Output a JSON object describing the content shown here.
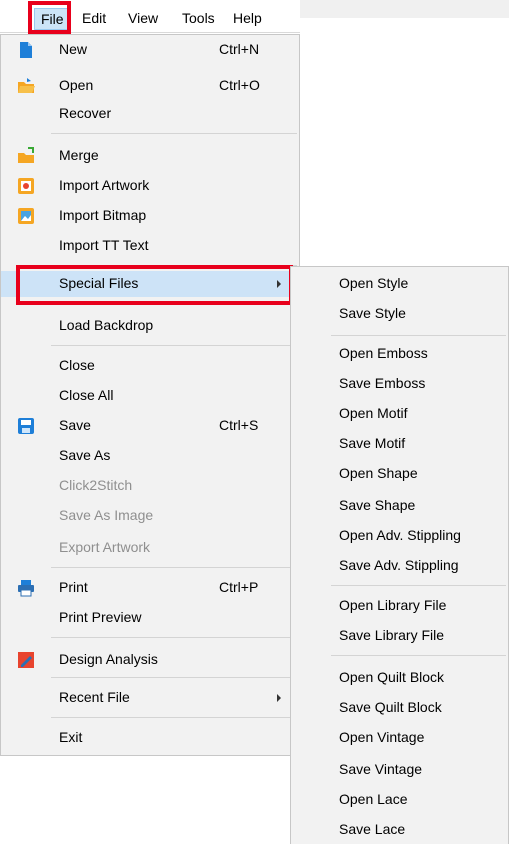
{
  "menubar": {
    "file": "File",
    "edit": "Edit",
    "view": "View",
    "tools": "Tools",
    "help": "Help"
  },
  "file_menu": {
    "items": [
      {
        "label": "New",
        "shortcut": "Ctrl+N",
        "icon": "new-file-icon"
      },
      {
        "label": "Open",
        "shortcut": "Ctrl+O",
        "icon": "open-folder-icon"
      },
      {
        "label": "Recover",
        "shortcut": ""
      },
      {
        "label": "Merge",
        "shortcut": "",
        "icon": "merge-folder-icon"
      },
      {
        "label": "Import Artwork",
        "shortcut": "",
        "icon": "import-artwork-icon"
      },
      {
        "label": "Import Bitmap",
        "shortcut": "",
        "icon": "import-bitmap-icon"
      },
      {
        "label": "Import TT Text",
        "shortcut": ""
      },
      {
        "label": "Special Files",
        "shortcut": "",
        "submenu": true,
        "selected": true
      },
      {
        "label": "Load Backdrop",
        "shortcut": ""
      },
      {
        "label": "Close",
        "shortcut": ""
      },
      {
        "label": "Close All",
        "shortcut": ""
      },
      {
        "label": "Save",
        "shortcut": "Ctrl+S",
        "icon": "save-icon"
      },
      {
        "label": "Save As",
        "shortcut": ""
      },
      {
        "label": "Click2Stitch",
        "shortcut": "",
        "disabled": true
      },
      {
        "label": "Save As Image",
        "shortcut": "",
        "disabled": true
      },
      {
        "label": "Export Artwork",
        "shortcut": "",
        "disabled": true
      },
      {
        "label": "Print",
        "shortcut": "Ctrl+P",
        "icon": "printer-icon"
      },
      {
        "label": "Print Preview",
        "shortcut": ""
      },
      {
        "label": "Design Analysis",
        "shortcut": "",
        "icon": "design-analysis-icon"
      },
      {
        "label": "Recent File",
        "shortcut": "",
        "submenu": true
      },
      {
        "label": "Exit",
        "shortcut": ""
      }
    ]
  },
  "special_files_menu": {
    "items": [
      "Open Style",
      "Save Style",
      "Open Emboss",
      "Save Emboss",
      "Open Motif",
      "Save Motif",
      "Open Shape",
      "Save Shape",
      "Open Adv. Stippling",
      "Save Adv. Stippling",
      "Open Library File",
      "Save Library File",
      "Open Quilt Block",
      "Save Quilt Block",
      "Open Vintage",
      "Save Vintage",
      "Open Lace",
      "Save Lace"
    ]
  },
  "colors": {
    "highlight_box": "#e8001c",
    "selected_item": "#cde3f7",
    "menu_bg": "#f2f2f2"
  }
}
